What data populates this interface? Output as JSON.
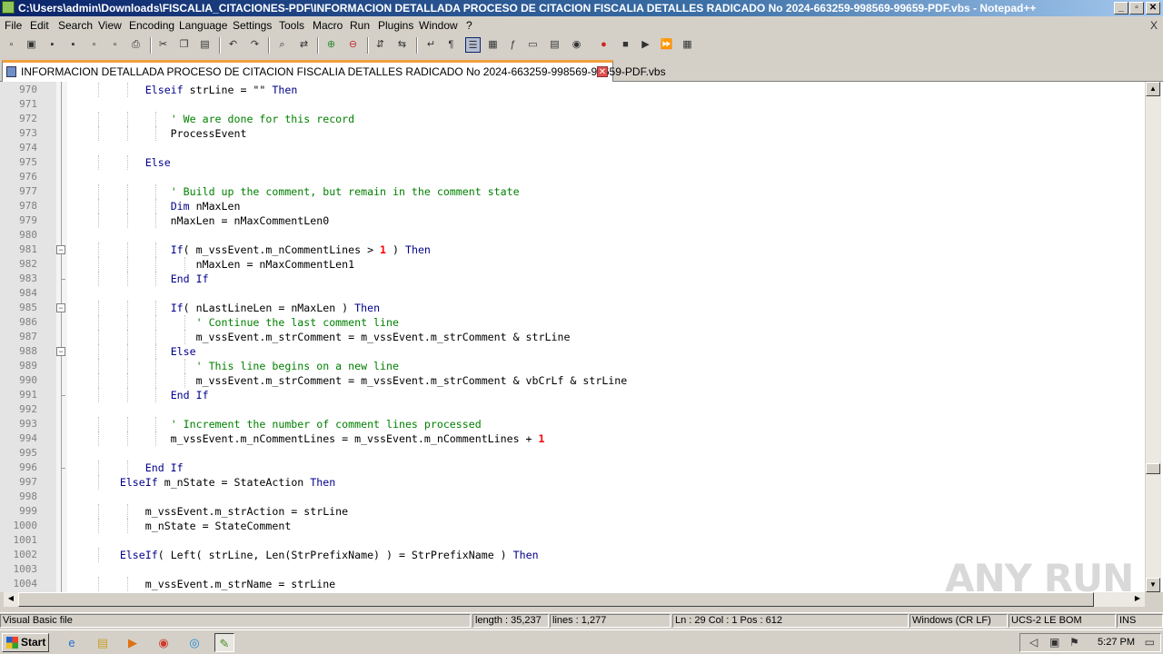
{
  "window": {
    "title": "C:\\Users\\admin\\Downloads\\FISCALIA_CITACIONES-PDF\\INFORMACION DETALLADA PROCESO DE CITACION FISCALIA DETALLES RADICADO No 2024-663259-998569-99659-PDF.vbs - Notepad++",
    "minimize": "_",
    "restore": "▫",
    "close": "✕"
  },
  "menubar": {
    "items": [
      "File",
      "Edit",
      "Search",
      "View",
      "Encoding",
      "Language",
      "Settings",
      "Tools",
      "Macro",
      "Run",
      "Plugins",
      "Window",
      "?"
    ],
    "close_x": "X"
  },
  "toolbar": {
    "icons": [
      "new-file-icon",
      "open-file-icon",
      "save-icon",
      "save-all-icon",
      "close-icon",
      "close-all-icon",
      "print-icon",
      "cut-icon",
      "copy-icon",
      "paste-icon",
      "undo-icon",
      "redo-icon",
      "find-icon",
      "replace-icon",
      "zoom-in-icon",
      "zoom-out-icon",
      "sync-vertical-icon",
      "sync-horizontal-icon",
      "word-wrap-icon",
      "show-all-chars-icon",
      "indent-guide-icon",
      "doc-map-icon",
      "function-list-icon",
      "folder-workspace-icon",
      "document-list-icon",
      "monitoring-icon",
      "record-macro-icon",
      "stop-macro-icon",
      "play-macro-icon",
      "run-macro-multiple-icon",
      "save-macro-icon"
    ]
  },
  "tab": {
    "label": "INFORMACION DETALLADA PROCESO DE CITACION FISCALIA DETALLES RADICADO No 2024-663259-998569-99659-PDF.vbs",
    "close": "✕"
  },
  "editor": {
    "lines": [
      {
        "n": "970",
        "fold": "",
        "segs": [
          {
            "c": "",
            "t": "            "
          },
          {
            "c": "kw",
            "t": "Elseif"
          },
          {
            "c": "",
            "t": " strLine = \"\" "
          },
          {
            "c": "kw",
            "t": "Then"
          }
        ]
      },
      {
        "n": "971",
        "fold": "",
        "segs": []
      },
      {
        "n": "972",
        "fold": "",
        "segs": [
          {
            "c": "",
            "t": "                "
          },
          {
            "c": "cm",
            "t": "' We are done for this record"
          }
        ]
      },
      {
        "n": "973",
        "fold": "",
        "segs": [
          {
            "c": "",
            "t": "                ProcessEvent"
          }
        ]
      },
      {
        "n": "974",
        "fold": "",
        "segs": []
      },
      {
        "n": "975",
        "fold": "",
        "segs": [
          {
            "c": "",
            "t": "            "
          },
          {
            "c": "kw",
            "t": "Else"
          }
        ]
      },
      {
        "n": "976",
        "fold": "",
        "segs": []
      },
      {
        "n": "977",
        "fold": "",
        "segs": [
          {
            "c": "",
            "t": "                "
          },
          {
            "c": "cm",
            "t": "' Build up the comment, but remain in the comment state"
          }
        ]
      },
      {
        "n": "978",
        "fold": "",
        "segs": [
          {
            "c": "",
            "t": "                "
          },
          {
            "c": "kw",
            "t": "Dim"
          },
          {
            "c": "",
            "t": " nMaxLen"
          }
        ]
      },
      {
        "n": "979",
        "fold": "",
        "segs": [
          {
            "c": "",
            "t": "                nMaxLen = nMaxCommentLen0"
          }
        ]
      },
      {
        "n": "980",
        "fold": "",
        "segs": []
      },
      {
        "n": "981",
        "fold": "box",
        "segs": [
          {
            "c": "",
            "t": "                "
          },
          {
            "c": "kw",
            "t": "If"
          },
          {
            "c": "",
            "t": "( m_vssEvent.m_nCommentLines > "
          },
          {
            "c": "num",
            "t": "1"
          },
          {
            "c": "",
            "t": " ) "
          },
          {
            "c": "kw",
            "t": "Then"
          }
        ]
      },
      {
        "n": "982",
        "fold": "",
        "segs": [
          {
            "c": "",
            "t": "                    nMaxLen = nMaxCommentLen1"
          }
        ]
      },
      {
        "n": "983",
        "fold": "end",
        "segs": [
          {
            "c": "",
            "t": "                "
          },
          {
            "c": "kw",
            "t": "End If"
          }
        ]
      },
      {
        "n": "984",
        "fold": "",
        "segs": []
      },
      {
        "n": "985",
        "fold": "box",
        "segs": [
          {
            "c": "",
            "t": "                "
          },
          {
            "c": "kw",
            "t": "If"
          },
          {
            "c": "",
            "t": "( nLastLineLen = nMaxLen ) "
          },
          {
            "c": "kw",
            "t": "Then"
          }
        ]
      },
      {
        "n": "986",
        "fold": "",
        "segs": [
          {
            "c": "",
            "t": "                    "
          },
          {
            "c": "cm",
            "t": "' Continue the last comment line"
          }
        ]
      },
      {
        "n": "987",
        "fold": "",
        "segs": [
          {
            "c": "",
            "t": "                    m_vssEvent.m_strComment = m_vssEvent.m_strComment & strLine"
          }
        ]
      },
      {
        "n": "988",
        "fold": "box",
        "segs": [
          {
            "c": "",
            "t": "                "
          },
          {
            "c": "kw",
            "t": "Else"
          }
        ]
      },
      {
        "n": "989",
        "fold": "",
        "segs": [
          {
            "c": "",
            "t": "                    "
          },
          {
            "c": "cm",
            "t": "' This line begins on a new line"
          }
        ]
      },
      {
        "n": "990",
        "fold": "",
        "segs": [
          {
            "c": "",
            "t": "                    m_vssEvent.m_strComment = m_vssEvent.m_strComment & vbCrLf & strLine"
          }
        ]
      },
      {
        "n": "991",
        "fold": "end",
        "segs": [
          {
            "c": "",
            "t": "                "
          },
          {
            "c": "kw",
            "t": "End If"
          }
        ]
      },
      {
        "n": "992",
        "fold": "",
        "segs": []
      },
      {
        "n": "993",
        "fold": "",
        "segs": [
          {
            "c": "",
            "t": "                "
          },
          {
            "c": "cm",
            "t": "' Increment the number of comment lines processed"
          }
        ]
      },
      {
        "n": "994",
        "fold": "",
        "segs": [
          {
            "c": "",
            "t": "                m_vssEvent.m_nCommentLines = m_vssEvent.m_nCommentLines + "
          },
          {
            "c": "num",
            "t": "1"
          }
        ]
      },
      {
        "n": "995",
        "fold": "",
        "segs": []
      },
      {
        "n": "996",
        "fold": "end",
        "segs": [
          {
            "c": "",
            "t": "            "
          },
          {
            "c": "kw",
            "t": "End If"
          }
        ]
      },
      {
        "n": "997",
        "fold": "",
        "segs": [
          {
            "c": "",
            "t": "        "
          },
          {
            "c": "kw",
            "t": "ElseIf"
          },
          {
            "c": "",
            "t": " m_nState = StateAction "
          },
          {
            "c": "kw",
            "t": "Then"
          }
        ]
      },
      {
        "n": "998",
        "fold": "",
        "segs": []
      },
      {
        "n": "999",
        "fold": "",
        "segs": [
          {
            "c": "",
            "t": "            m_vssEvent.m_strAction = strLine"
          }
        ]
      },
      {
        "n": "1000",
        "fold": "",
        "segs": [
          {
            "c": "",
            "t": "            m_nState = StateComment"
          }
        ]
      },
      {
        "n": "1001",
        "fold": "",
        "segs": []
      },
      {
        "n": "1002",
        "fold": "",
        "segs": [
          {
            "c": "",
            "t": "        "
          },
          {
            "c": "kw",
            "t": "ElseIf"
          },
          {
            "c": "",
            "t": "( Left( strLine, Len(StrPrefixName) ) = StrPrefixName ) "
          },
          {
            "c": "kw",
            "t": "Then"
          }
        ]
      },
      {
        "n": "1003",
        "fold": "",
        "segs": []
      },
      {
        "n": "1004",
        "fold": "",
        "segs": [
          {
            "c": "",
            "t": "            m_vssEvent.m_strName = strLine"
          }
        ]
      }
    ]
  },
  "statusbar": {
    "language": "Visual Basic file",
    "length": "length : 35,237",
    "lines": "lines : 1,277",
    "position": "Ln : 29    Col : 1    Pos : 612",
    "eol": "Windows (CR LF)",
    "encoding": "UCS-2 LE BOM",
    "mode": "INS"
  },
  "taskbar": {
    "start_label": "Start",
    "apps": [
      {
        "name": "ie-icon",
        "glyph": "e",
        "color": "#1e6fd0"
      },
      {
        "name": "explorer-icon",
        "glyph": "▤",
        "color": "#c9a030"
      },
      {
        "name": "media-player-icon",
        "glyph": "▶",
        "color": "#e07010"
      },
      {
        "name": "chrome-icon",
        "glyph": "◉",
        "color": "#d03a2a"
      },
      {
        "name": "edge-icon",
        "glyph": "◎",
        "color": "#1a8ad8"
      },
      {
        "name": "notepadpp-icon",
        "glyph": "✎",
        "color": "#4a8a2a"
      }
    ],
    "clock": "5:27 PM"
  },
  "watermark": "ANY RUN"
}
